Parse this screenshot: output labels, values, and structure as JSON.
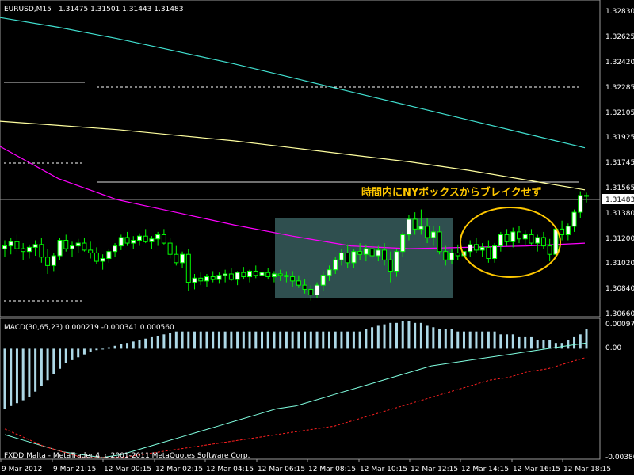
{
  "header": {
    "symbol": "EURUSD,M15",
    "ohlc": "1.31475 1.31501 1.31443 1.31483"
  },
  "macd_header": {
    "label": "MACD(30,65,23) 0.000219 -0.000341 0.000560"
  },
  "copyright": "FXDD Malta - MetaTrader 4, c 2001-2011 MetaQuotes Software Corp.",
  "annotation": "時間内にNYボックスからブレイクせず",
  "price_labels": [
    "1.32830",
    "1.32625",
    "1.32420",
    "1.32285",
    "1.32105",
    "1.31925",
    "1.31745",
    "1.31565",
    "1.31483",
    "1.31380",
    "1.31200",
    "1.31020",
    "1.30840",
    "1.30660"
  ],
  "macd_labels": [
    "0.000978",
    "0.00",
    "-0.00380"
  ],
  "time_labels": [
    "9 Mar 2012",
    "9 Mar 21:15",
    "12 Mar 00:15",
    "12 Mar 02:15",
    "12 Mar 04:15",
    "12 Mar 06:15",
    "12 Mar 08:15",
    "12 Mar 10:15",
    "12 Mar 12:15",
    "12 Mar 14:15",
    "12 Mar 16:15",
    "12 Mar 18:15"
  ],
  "colors": {
    "background": "#000000",
    "bull_candle": "#ffffff",
    "bear_candle": "#000000",
    "wick": "#00ff00",
    "ma_cyan": "#40e0d0",
    "ma_yellow": "#ffff9f",
    "ma_magenta": "#ff00ff",
    "macd_hist": "#add8e6",
    "macd_signal_cyan": "#80ffe0",
    "macd_signal_red": "#ff2020",
    "box_fill": "#2f4f4f",
    "annotation": "#ffc800",
    "ellipse": "#ffc800"
  },
  "chart_data": [
    {
      "type": "candlestick",
      "title": "EURUSD,M15",
      "ylim": [
        1.3066,
        1.3283
      ],
      "x": [
        "9 Mar 2012",
        "9 Mar 21:15",
        "12 Mar 00:15",
        "12 Mar 02:15",
        "12 Mar 04:15",
        "12 Mar 06:15",
        "12 Mar 08:15",
        "12 Mar 10:15",
        "12 Mar 12:15",
        "12 Mar 14:15",
        "12 Mar 16:15",
        "12 Mar 18:15"
      ],
      "candles": [
        [
          1.311,
          1.3116,
          1.3104,
          1.3112
        ],
        [
          1.3112,
          1.3118,
          1.3106,
          1.3115
        ],
        [
          1.3115,
          1.312,
          1.3108,
          1.311
        ],
        [
          1.311,
          1.3114,
          1.3102,
          1.3108
        ],
        [
          1.3108,
          1.3113,
          1.3103,
          1.3111
        ],
        [
          1.3111,
          1.3116,
          1.3105,
          1.3113
        ],
        [
          1.3113,
          1.3118,
          1.31,
          1.3104
        ],
        [
          1.3104,
          1.311,
          1.3092,
          1.3098
        ],
        [
          1.3098,
          1.3107,
          1.3094,
          1.3105
        ],
        [
          1.3105,
          1.3118,
          1.3102,
          1.3116
        ],
        [
          1.3116,
          1.312,
          1.3108,
          1.311
        ],
        [
          1.311,
          1.3115,
          1.3104,
          1.3112
        ],
        [
          1.3112,
          1.3117,
          1.3107,
          1.3114
        ],
        [
          1.3114,
          1.3118,
          1.3108,
          1.3109
        ],
        [
          1.3109,
          1.3115,
          1.3103,
          1.3107
        ],
        [
          1.3107,
          1.3111,
          1.3099,
          1.3101
        ],
        [
          1.3101,
          1.3106,
          1.3095,
          1.3103
        ],
        [
          1.3103,
          1.311,
          1.31,
          1.3108
        ],
        [
          1.3108,
          1.3114,
          1.3104,
          1.3112
        ],
        [
          1.3112,
          1.312,
          1.3109,
          1.3118
        ],
        [
          1.3118,
          1.3122,
          1.3112,
          1.3114
        ],
        [
          1.3114,
          1.3119,
          1.311,
          1.3116
        ],
        [
          1.3116,
          1.3121,
          1.3112,
          1.3119
        ],
        [
          1.3119,
          1.3124,
          1.3114,
          1.3115
        ],
        [
          1.3115,
          1.3119,
          1.311,
          1.3117
        ],
        [
          1.3117,
          1.3122,
          1.3112,
          1.312
        ],
        [
          1.312,
          1.3124,
          1.3113,
          1.3114
        ],
        [
          1.3114,
          1.3118,
          1.3103,
          1.3106
        ],
        [
          1.3106,
          1.3112,
          1.3098,
          1.31
        ],
        [
          1.31,
          1.3108,
          1.3096,
          1.3106
        ],
        [
          1.3106,
          1.311,
          1.308,
          1.3086
        ],
        [
          1.3086,
          1.3092,
          1.3081,
          1.3089
        ],
        [
          1.3089,
          1.3093,
          1.3084,
          1.3087
        ],
        [
          1.3087,
          1.3092,
          1.3083,
          1.309
        ],
        [
          1.309,
          1.3094,
          1.3086,
          1.3088
        ],
        [
          1.3088,
          1.3093,
          1.3085,
          1.3091
        ],
        [
          1.3091,
          1.3095,
          1.3086,
          1.3092
        ],
        [
          1.3092,
          1.3096,
          1.3087,
          1.3088
        ],
        [
          1.3088,
          1.3094,
          1.3084,
          1.3093
        ],
        [
          1.3093,
          1.3097,
          1.3088,
          1.309
        ],
        [
          1.309,
          1.3095,
          1.3086,
          1.3094
        ],
        [
          1.3094,
          1.3098,
          1.3089,
          1.3091
        ],
        [
          1.3091,
          1.3095,
          1.3087,
          1.3093
        ],
        [
          1.3093,
          1.3096,
          1.3088,
          1.309
        ],
        [
          1.309,
          1.3094,
          1.3086,
          1.3092
        ],
        [
          1.3092,
          1.3095,
          1.3087,
          1.3091
        ],
        [
          1.3091,
          1.3094,
          1.3086,
          1.309
        ],
        [
          1.309,
          1.3094,
          1.3083,
          1.3087
        ],
        [
          1.3087,
          1.3091,
          1.3082,
          1.3084
        ],
        [
          1.3084,
          1.3088,
          1.3078,
          1.3081
        ],
        [
          1.3081,
          1.3084,
          1.3073,
          1.3077
        ],
        [
          1.3077,
          1.3086,
          1.3075,
          1.3084
        ],
        [
          1.3084,
          1.3094,
          1.308,
          1.3091
        ],
        [
          1.3091,
          1.3098,
          1.3087,
          1.3095
        ],
        [
          1.3095,
          1.3104,
          1.3092,
          1.3102
        ],
        [
          1.3102,
          1.311,
          1.3098,
          1.3107
        ],
        [
          1.3107,
          1.3113,
          1.3096,
          1.31
        ],
        [
          1.31,
          1.311,
          1.3096,
          1.3108
        ],
        [
          1.3108,
          1.3114,
          1.3102,
          1.3106
        ],
        [
          1.3106,
          1.3113,
          1.3101,
          1.311
        ],
        [
          1.311,
          1.3114,
          1.3103,
          1.3105
        ],
        [
          1.3105,
          1.3112,
          1.3101,
          1.3109
        ],
        [
          1.3109,
          1.3114,
          1.3098,
          1.3102
        ],
        [
          1.3102,
          1.3108,
          1.3086,
          1.3094
        ],
        [
          1.3094,
          1.311,
          1.309,
          1.3108
        ],
        [
          1.3108,
          1.3122,
          1.3104,
          1.312
        ],
        [
          1.312,
          1.3134,
          1.3116,
          1.3131
        ],
        [
          1.3131,
          1.3136,
          1.312,
          1.3124
        ],
        [
          1.3124,
          1.3138,
          1.312,
          1.3126
        ],
        [
          1.3126,
          1.3132,
          1.3114,
          1.3118
        ],
        [
          1.3118,
          1.3126,
          1.3112,
          1.3122
        ],
        [
          1.3122,
          1.3126,
          1.3106,
          1.3108
        ],
        [
          1.3108,
          1.3112,
          1.3098,
          1.3102
        ],
        [
          1.3102,
          1.311,
          1.3099,
          1.3107
        ],
        [
          1.3107,
          1.3113,
          1.3102,
          1.3105
        ],
        [
          1.3105,
          1.311,
          1.31,
          1.3108
        ],
        [
          1.3108,
          1.3116,
          1.3104,
          1.3113
        ],
        [
          1.3113,
          1.3118,
          1.3107,
          1.3109
        ],
        [
          1.3109,
          1.3114,
          1.3104,
          1.3111
        ],
        [
          1.3111,
          1.3116,
          1.31,
          1.3103
        ],
        [
          1.3103,
          1.3114,
          1.31,
          1.3112
        ],
        [
          1.3112,
          1.3122,
          1.3108,
          1.312
        ],
        [
          1.312,
          1.3124,
          1.3112,
          1.3115
        ],
        [
          1.3115,
          1.3125,
          1.3111,
          1.3122
        ],
        [
          1.3122,
          1.3126,
          1.3114,
          1.3117
        ],
        [
          1.3117,
          1.3123,
          1.3112,
          1.312
        ],
        [
          1.312,
          1.3124,
          1.3113,
          1.3114
        ],
        [
          1.3114,
          1.312,
          1.3108,
          1.3118
        ],
        [
          1.3118,
          1.3122,
          1.311,
          1.3112
        ],
        [
          1.3112,
          1.3117,
          1.3101,
          1.3106
        ],
        [
          1.3106,
          1.3126,
          1.3103,
          1.3124
        ],
        [
          1.3124,
          1.313,
          1.3116,
          1.312
        ],
        [
          1.312,
          1.3128,
          1.3116,
          1.3126
        ],
        [
          1.3126,
          1.3138,
          1.3122,
          1.3136
        ],
        [
          1.3136,
          1.3151,
          1.3132,
          1.3148
        ],
        [
          1.3148,
          1.315,
          1.3143,
          1.3148
        ]
      ],
      "series": [
        {
          "values": [
            1.3275,
            1.3268,
            1.326,
            1.3251,
            1.3242,
            1.3232,
            1.3222,
            1.3212,
            1.3202,
            1.3192,
            1.3182
          ]
        },
        {
          "values": [
            1.3201,
            1.3198,
            1.3195,
            1.3191,
            1.3187,
            1.3182,
            1.3177,
            1.3172,
            1.3166,
            1.3159,
            1.3152
          ]
        },
        {
          "values": [
            1.3183,
            1.316,
            1.3145,
            1.3136,
            1.3127,
            1.3119,
            1.3112,
            1.311,
            1.3111,
            1.3112,
            1.3114
          ]
        }
      ],
      "annotations": [
        {
          "type": "hline",
          "y": 1.3148
        },
        {
          "type": "rect",
          "x_range": [
            "12 Mar 06:15",
            "12 Mar 13:00"
          ],
          "y_range": [
            1.3078,
            1.3135
          ]
        },
        {
          "type": "ellipse",
          "x_range": [
            "12 Mar 13:00",
            "12 Mar 17:30"
          ],
          "y_range": [
            1.31,
            1.3142
          ]
        }
      ]
    },
    {
      "type": "bar+line",
      "title": "MACD(30,65,23)",
      "ylim": [
        -0.0038,
        0.000978
      ],
      "histogram": [
        -0.0021,
        -0.002,
        -0.0019,
        -0.0018,
        -0.0017,
        -0.0015,
        -0.0013,
        -0.0011,
        -0.0009,
        -0.0007,
        -0.0005,
        -0.0004,
        -0.0003,
        -0.0002,
        -0.0001,
        -5e-05,
        0.0,
        5e-05,
        0.0001,
        0.00015,
        0.0002,
        0.00025,
        0.0003,
        0.00035,
        0.0004,
        0.00045,
        0.0005,
        0.00055,
        0.0006,
        0.0006,
        0.0006,
        0.0006,
        0.0006,
        0.0006,
        0.0006,
        0.0006,
        0.0006,
        0.0006,
        0.0006,
        0.0006,
        0.0006,
        0.0006,
        0.0006,
        0.0006,
        0.0006,
        0.0006,
        0.0006,
        0.0006,
        0.0006,
        0.0006,
        0.0006,
        0.0006,
        0.0006,
        0.0006,
        0.0006,
        0.0006,
        0.0006,
        0.0006,
        0.0006,
        0.0007,
        0.00075,
        0.0008,
        0.00085,
        0.0009,
        0.0009,
        0.00095,
        0.00095,
        0.0009,
        0.0009,
        0.0008,
        0.00075,
        0.0007,
        0.0007,
        0.0007,
        0.0006,
        0.0006,
        0.0006,
        0.0006,
        0.0006,
        0.0006,
        0.0006,
        0.0005,
        0.0005,
        0.0005,
        0.0004,
        0.0004,
        0.0004,
        0.0003,
        0.0003,
        0.0003,
        0.0002,
        0.0002,
        0.0003,
        0.0004,
        0.0005,
        0.0007
      ],
      "series": [
        {
          "values": [
            -0.003,
            -0.0032,
            -0.0034,
            -0.0036,
            -0.0037,
            -0.0038,
            -0.0037,
            -0.0035,
            -0.0033,
            -0.0031,
            -0.0029,
            -0.0027,
            -0.0025,
            -0.0023,
            -0.0021,
            -0.002,
            -0.0018,
            -0.0016,
            -0.0014,
            -0.0012,
            -0.001,
            -0.0008,
            -0.0006,
            -0.0005,
            -0.0004,
            -0.0003,
            -0.0002,
            -0.0001,
            0.0,
            0.0001,
            0.0002
          ]
        },
        {
          "values": [
            -0.0028,
            -0.0031,
            -0.0034,
            -0.0036,
            -0.0038,
            -0.0038,
            -0.0038,
            -0.0037,
            -0.0036,
            -0.0035,
            -0.0034,
            -0.0033,
            -0.0032,
            -0.0031,
            -0.003,
            -0.0029,
            -0.0028,
            -0.0027,
            -0.0025,
            -0.0023,
            -0.0021,
            -0.0019,
            -0.0017,
            -0.0015,
            -0.0013,
            -0.0011,
            -0.001,
            -0.0008,
            -0.0007,
            -0.0005,
            -0.0003
          ]
        }
      ]
    }
  ]
}
